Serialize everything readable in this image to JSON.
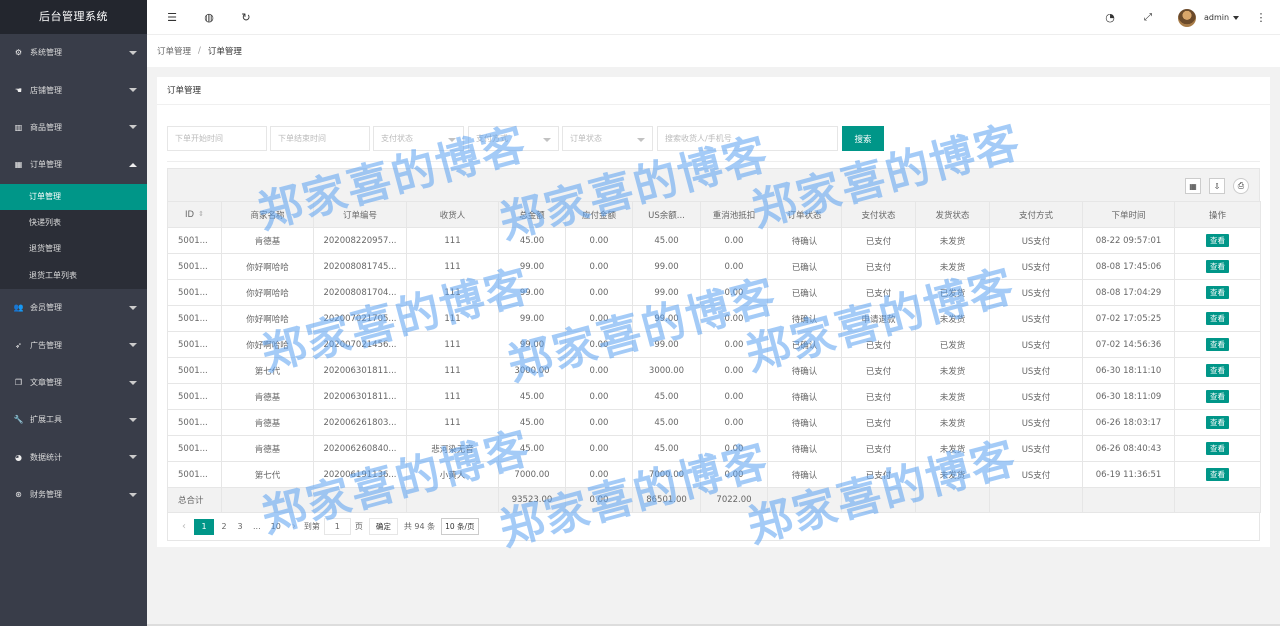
{
  "app": {
    "title": "后台管理系统"
  },
  "sidebar": {
    "items": [
      {
        "label": "系统管理",
        "icon": "gear-icon",
        "glyph": "⚙"
      },
      {
        "label": "店铺管理",
        "icon": "hand-icon",
        "glyph": "☚"
      },
      {
        "label": "商品管理",
        "icon": "chart-icon",
        "glyph": "▥"
      },
      {
        "label": "订单管理",
        "icon": "calendar-icon",
        "glyph": "▦"
      },
      {
        "label": "会员管理",
        "icon": "users-icon",
        "glyph": "👥"
      },
      {
        "label": "广告管理",
        "icon": "rocket-icon",
        "glyph": "➶"
      },
      {
        "label": "文章管理",
        "icon": "file-icon",
        "glyph": "❐"
      },
      {
        "label": "扩展工具",
        "icon": "wrench-icon",
        "glyph": "🔧"
      },
      {
        "label": "数据统计",
        "icon": "pie-icon",
        "glyph": "◕"
      },
      {
        "label": "财务管理",
        "icon": "money-icon",
        "glyph": "⊛"
      }
    ],
    "order_sub": [
      "订单管理",
      "快递列表",
      "退货管理",
      "退货工单列表"
    ]
  },
  "header": {
    "user": "admin"
  },
  "breadcrumb": {
    "parent": "订单管理",
    "sep": "/",
    "current": "订单管理"
  },
  "card": {
    "title": "订单管理"
  },
  "filters": {
    "start": "下单开始时间",
    "end": "下单结束时间",
    "pay_status": "支付状态",
    "pay_method": "支付方式",
    "order_status": "订单状态",
    "keyword": "搜索收货人/手机号",
    "search": "搜索"
  },
  "table": {
    "headers": [
      "ID",
      "商家名称",
      "订单编号",
      "收货人",
      "总金额",
      "应付金额",
      "US余额...",
      "重消池抵扣",
      "订单状态",
      "支付状态",
      "发货状态",
      "支付方式",
      "下单时间",
      "操作"
    ],
    "view_label": "查看",
    "rows": [
      [
        "5001...",
        "肯德基",
        "202008220957...",
        "111",
        "45.00",
        "0.00",
        "45.00",
        "0.00",
        "待确认",
        "已支付",
        "未发货",
        "US支付",
        "08-22 09:57:01"
      ],
      [
        "5001...",
        "你好啊哈哈",
        "202008081745...",
        "111",
        "99.00",
        "0.00",
        "99.00",
        "0.00",
        "已确认",
        "已支付",
        "未发货",
        "US支付",
        "08-08 17:45:06"
      ],
      [
        "5001...",
        "你好啊哈哈",
        "202008081704...",
        "111",
        "99.00",
        "0.00",
        "99.00",
        "0.00",
        "已确认",
        "已支付",
        "已发货",
        "US支付",
        "08-08 17:04:29"
      ],
      [
        "5001...",
        "你好啊哈哈",
        "202007021705...",
        "111",
        "99.00",
        "0.00",
        "99.00",
        "0.00",
        "待确认",
        "申请退款",
        "未发货",
        "US支付",
        "07-02 17:05:25"
      ],
      [
        "5001...",
        "你好啊哈哈",
        "202007021456...",
        "111",
        "99.00",
        "0.00",
        "99.00",
        "0.00",
        "已确认",
        "已支付",
        "已发货",
        "US支付",
        "07-02 14:56:36"
      ],
      [
        "5001...",
        "第七代",
        "202006301811...",
        "111",
        "3000.00",
        "0.00",
        "3000.00",
        "0.00",
        "待确认",
        "已支付",
        "未发货",
        "US支付",
        "06-30 18:11:10"
      ],
      [
        "5001...",
        "肯德基",
        "202006301811...",
        "111",
        "45.00",
        "0.00",
        "45.00",
        "0.00",
        "待确认",
        "已支付",
        "未发货",
        "US支付",
        "06-30 18:11:09"
      ],
      [
        "5001...",
        "肯德基",
        "202006261803...",
        "111",
        "45.00",
        "0.00",
        "45.00",
        "0.00",
        "待确认",
        "已支付",
        "未发货",
        "US支付",
        "06-26 18:03:17"
      ],
      [
        "5001...",
        "肯德基",
        "202006260840...",
        "悲河染无音",
        "45.00",
        "0.00",
        "45.00",
        "0.00",
        "待确认",
        "已支付",
        "未发货",
        "US支付",
        "06-26 08:40:43"
      ],
      [
        "5001...",
        "第七代",
        "202006191136...",
        "小黄人",
        "7000.00",
        "0.00",
        "7000.00",
        "0.00",
        "待确认",
        "已支付",
        "未发货",
        "US支付",
        "06-19 11:36:51"
      ]
    ],
    "sum": {
      "label": "总合计",
      "total": "93523.00",
      "payable": "0.00",
      "us": "86501.00",
      "deduct": "7022.00"
    }
  },
  "pager": {
    "prev": "‹",
    "next": "›",
    "pages": [
      "1",
      "2",
      "3",
      "...",
      "10"
    ],
    "goto": "到第",
    "page_value": "1",
    "page_unit": "页",
    "ok": "确定",
    "total": "共 94 条",
    "size": "10 条/页"
  },
  "watermark": "郑家喜的博客"
}
